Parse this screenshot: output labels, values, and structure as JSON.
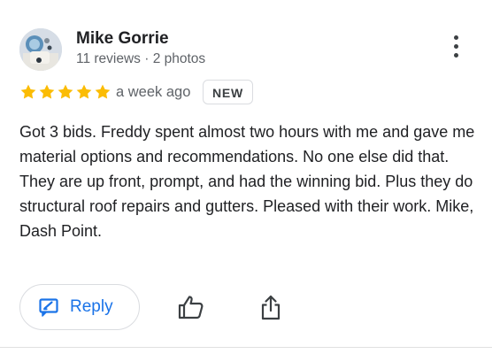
{
  "reviewer": {
    "name": "Mike Gorrie",
    "stats": "11 reviews · 2 photos"
  },
  "rating": {
    "stars": 5,
    "max": 5,
    "star_color": "#fbbc04",
    "time_ago": "a week ago",
    "badge": "NEW"
  },
  "review": {
    "paragraphs": [
      "Got 3 bids. Freddy spent almost two hours with me and gave me material options and recommendations. No one else did that.",
      "They are up front, prompt, and had the winning bid. Plus they do structural roof repairs and gutters. Pleased with their work. Mike, Dash Point."
    ]
  },
  "actions": {
    "reply_label": "Reply",
    "reply_icon": "reply-icon",
    "like_icon": "thumbs-up-icon",
    "share_icon": "share-icon",
    "menu_icon": "more-vert-icon"
  },
  "colors": {
    "accent": "#1a73e8",
    "secondary_text": "#5f6368"
  }
}
